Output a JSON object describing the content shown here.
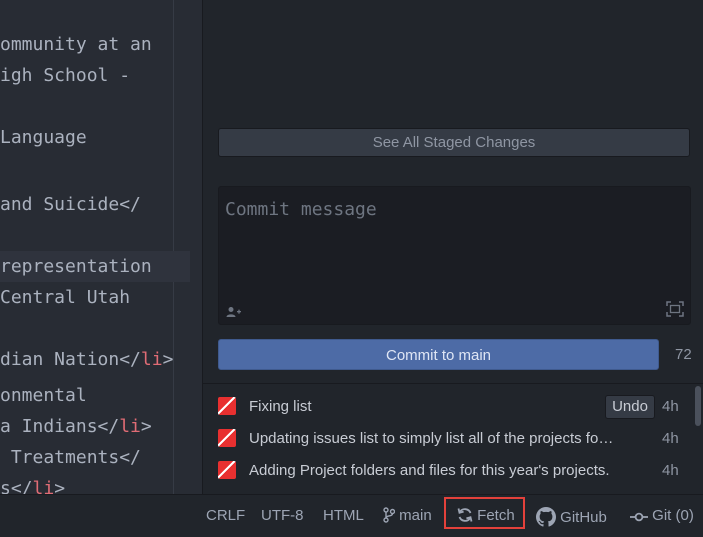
{
  "editor": {
    "lines": [
      {
        "text": "ommunity at an",
        "tag_after": ""
      },
      {
        "text": "igh School -",
        "tag_after": ""
      },
      {
        "text": "Language",
        "tag_after": ""
      },
      {
        "text": "and Suicide</",
        "tag_after": ""
      },
      {
        "text": "representation",
        "tag_after": ""
      },
      {
        "text": "Central Utah",
        "tag_after": ""
      },
      {
        "text": "dian Nation</",
        "tag": "li",
        "close": ">"
      },
      {
        "text": "onmental",
        "tag_after": ""
      },
      {
        "text": "a Indians</",
        "tag": "li",
        "close": ">"
      },
      {
        "text": " Treatments</",
        "tag_after": ""
      },
      {
        "text": "s</",
        "tag": "li",
        "close": ">"
      }
    ]
  },
  "git_panel": {
    "staged_button_label": "See All Staged Changes",
    "commit_placeholder": "Commit message",
    "commit_button_label": "Commit to main",
    "char_count": "72",
    "undo_label": "Undo",
    "commits": [
      {
        "message": "Fixing list",
        "time": "4h"
      },
      {
        "message": "Updating issues list to simply list all of the projects for This i...",
        "time": "4h"
      },
      {
        "message": "Adding Project folders and files for this year's projects.",
        "time": "4h"
      }
    ]
  },
  "status_bar": {
    "line_ending": "CRLF",
    "encoding": "UTF-8",
    "grammar": "HTML",
    "branch": "main",
    "fetch_label": "Fetch",
    "github_label": "GitHub",
    "git_label": "Git (0)"
  },
  "colors": {
    "fetch_highlight": "#e3413b",
    "commit_button": "#4d6ba6",
    "tag": "#e06c75"
  }
}
